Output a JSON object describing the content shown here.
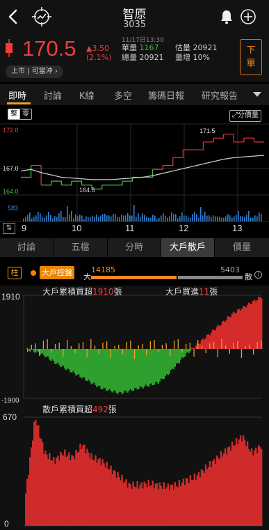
{
  "header": {
    "title": "智原",
    "code": "3035"
  },
  "quote": {
    "price": "170.5",
    "change": "▲3.50",
    "change_pct": "(2.1%)",
    "timestamp": "11/17日13:30",
    "unit_volume_label": "單量",
    "unit_volume": "1167",
    "total_volume_label": "總量",
    "total_volume": "20921",
    "est_volume_label": "估量",
    "est_volume": "20921",
    "volume_increase_label": "量增",
    "volume_increase": "10%",
    "order_button": "下單",
    "listing": "上市 | 可當沖"
  },
  "main_tabs": [
    "即時",
    "討論",
    "K線",
    "多空",
    "籌碼日報",
    "研究報告"
  ],
  "intraday": {
    "btn_whole": "整",
    "btn_zero": "零",
    "btn_share": "分價量",
    "y_high": "172.0",
    "y_mid": "167.0",
    "y_low": "164.0",
    "vol_label": "583",
    "high_mark": "171.5",
    "low_mark": "164.5",
    "x_labels": [
      "9",
      "10",
      "11",
      "12",
      "13"
    ]
  },
  "sub_tabs": [
    "討論",
    "五檔",
    "分時",
    "大戶散戶",
    "價量"
  ],
  "big_players": {
    "col_btn": "柱",
    "control_label": "大戶控盤",
    "big_label": "大",
    "big_value": "14185",
    "retail_value": "5403",
    "retail_label": "散",
    "cum_title_prefix": "大戶累積買超",
    "cum_value": "1910",
    "unit": "張",
    "buy_title_prefix": "大戶買進",
    "buy_value": "11",
    "y_top": "1910",
    "y_bottom": "-1900",
    "retail_title_prefix": "散戶累積買超",
    "retail_cum_value": "492",
    "retail_y_top": "670",
    "retail_y_bottom": "0"
  },
  "chart_data": [
    {
      "type": "line",
      "title": "",
      "xlabel": "",
      "ylabel": "",
      "x_ticks": [
        "9",
        "10",
        "11",
        "12",
        "13"
      ],
      "ylim": [
        164.0,
        172.0
      ],
      "series": [
        {
          "values": [
            166.0,
            167.5,
            165.0,
            165.5,
            165.0,
            165.5,
            165.0,
            164.5,
            165.0,
            165.0,
            165.5,
            166.0,
            166.0,
            167.0,
            167.5,
            168.5,
            169.5,
            169.5,
            170.5,
            171.0,
            171.5,
            170.5,
            171.0,
            170.5,
            170.5
          ]
        },
        {
          "values": [
            166.8,
            167.0,
            166.6,
            166.3,
            166.0,
            165.9,
            165.8,
            165.7,
            165.7,
            165.7,
            165.8,
            165.9,
            166.0,
            166.2,
            166.5,
            166.8,
            167.1,
            167.4,
            167.7,
            168.0,
            168.3,
            168.5,
            168.6,
            168.7,
            168.8
          ]
        }
      ]
    },
    {
      "type": "bar",
      "title": "大戶累積買超",
      "ylim": [
        -1900,
        1910
      ],
      "values": [
        0,
        -100,
        -250,
        -500,
        -700,
        -900,
        -1100,
        -1300,
        -1500,
        -1600,
        -1700,
        -1600,
        -1500,
        -1400,
        -1300,
        -1000,
        -600,
        -200,
        100,
        400,
        700,
        1000,
        1300,
        1500,
        1700,
        1910
      ]
    },
    {
      "type": "bar",
      "title": "散戶累積買超",
      "ylim": [
        0,
        670
      ],
      "values": [
        200,
        670,
        450,
        400,
        450,
        420,
        500,
        420,
        400,
        350,
        300,
        250,
        250,
        260,
        250,
        240,
        250,
        280,
        300,
        350,
        400,
        450,
        500,
        550,
        450,
        492
      ]
    }
  ]
}
